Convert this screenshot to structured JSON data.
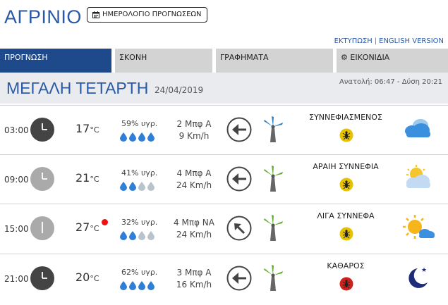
{
  "header": {
    "city": "ΑΓΡΙΝΙΟ",
    "calendar_button": "ΗΜΕΡΟΛΟΓΙΟ ΠΡΟΓΝΩΣΕΩΝ",
    "print_link": "ΕΚΤΥΠΩΣΗ",
    "separator": "|",
    "english_link": "ENGLISH VERSION"
  },
  "tabs": [
    {
      "label": "ΠΡΟΓΝΩΣΗ",
      "active": true
    },
    {
      "label": "ΣΚΟΝΗ",
      "active": false
    },
    {
      "label": "ΓΡΑΦΗΜΑΤΑ",
      "active": false
    },
    {
      "label": "ΕΙΚΟΝΙΔΙΑ",
      "active": false
    }
  ],
  "day": {
    "name": "ΜΕΓΑΛΗ ΤΕΤΑΡΤΗ",
    "date": "24/04/2019",
    "sun_times": "Ανατολή: 06:47  - Δύση 20:21"
  },
  "rows": [
    {
      "time": "03:00",
      "temp": "17",
      "unit": "°C",
      "humidity": "59% υγρ.",
      "drops_filled": 4,
      "wind_force": "2 Μπφ Α",
      "wind_speed": "9 Km/h",
      "arrow_dir": "left",
      "condition": "ΣΥΝΝΕΦΙΑΣΜΕΝΟΣ",
      "bug_color": "#e6c200",
      "icon": "cloudy-icon",
      "clock_dark": true,
      "alert": false
    },
    {
      "time": "09:00",
      "temp": "21",
      "unit": "°C",
      "humidity": "41% υγρ.",
      "drops_filled": 2,
      "wind_force": "4 Μπφ Α",
      "wind_speed": "24 Km/h",
      "arrow_dir": "left",
      "condition": "ΑΡΑΙΗ ΣΥΝΝΕΦΙΑ",
      "bug_color": "#e6c200",
      "icon": "partly-cloudy-icon",
      "clock_dark": false,
      "alert": false
    },
    {
      "time": "15:00",
      "temp": "27",
      "unit": "°C",
      "humidity": "32% υγρ.",
      "drops_filled": 2,
      "wind_force": "4 Μπφ ΝΑ",
      "wind_speed": "24 Km/h",
      "arrow_dir": "up-left",
      "condition": "ΛΙΓΑ ΣΥΝΝΕΦΑ",
      "bug_color": "#e6c200",
      "icon": "sun-cloud-icon",
      "clock_dark": false,
      "alert": true
    },
    {
      "time": "21:00",
      "temp": "20",
      "unit": "°C",
      "humidity": "62% υγρ.",
      "drops_filled": 4,
      "wind_force": "3 Μπφ Α",
      "wind_speed": "16 Km/h",
      "arrow_dir": "left",
      "condition": "ΚΑΘΑΡΟΣ",
      "bug_color": "#d0201c",
      "icon": "moon-icon",
      "clock_dark": true,
      "alert": false
    }
  ],
  "colors": {
    "accent": "#2a5aa6",
    "tab_active": "#1e4a8c",
    "drop_filled": "#2f7fd6",
    "drop_empty": "#b9c3cc"
  }
}
